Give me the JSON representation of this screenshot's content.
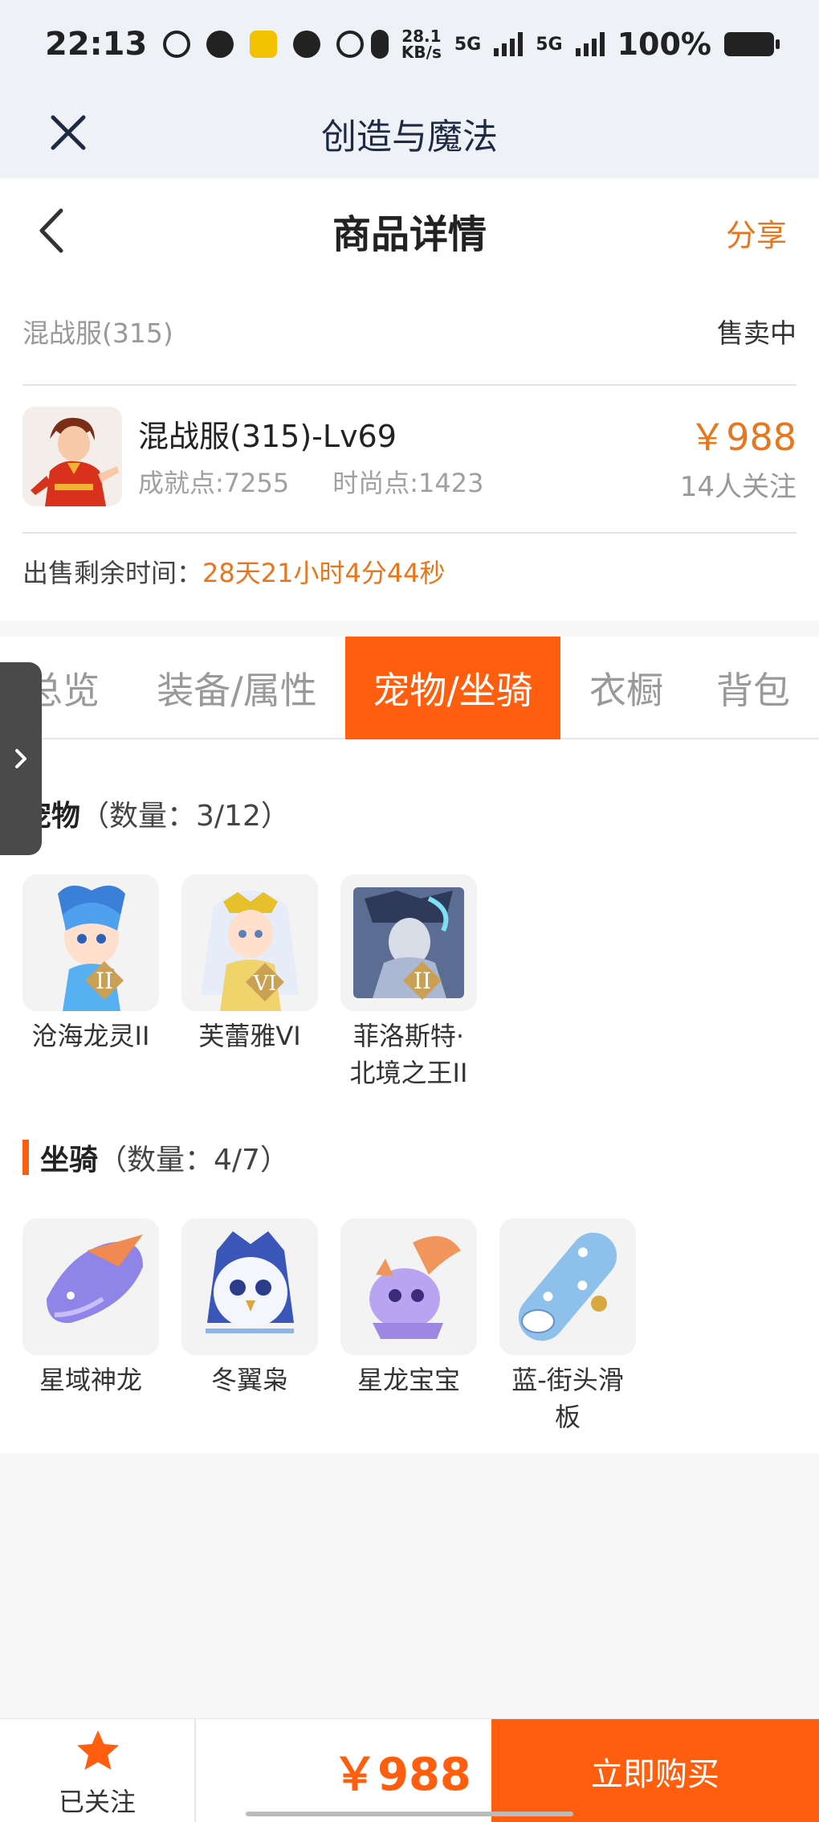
{
  "status_bar": {
    "time": "22:13",
    "net_speed_value": "28.1",
    "net_speed_unit": "KB/s",
    "sim1": "5G",
    "sim2": "5G",
    "battery": "100%"
  },
  "app_header": {
    "title": "创造与魔法"
  },
  "nav": {
    "title": "商品详情",
    "share_label": "分享"
  },
  "listing": {
    "server": "混战服(315)",
    "status": "售卖中",
    "character_name": "混战服(315)-Lv69",
    "achievement": "成就点:7255",
    "fashion": "时尚点:1423",
    "price": "￥988",
    "followers": "14人关注",
    "time_left_label": "出售剩余时间：",
    "time_left_value": "28天21小时4分44秒"
  },
  "tabs": [
    {
      "label": "总览"
    },
    {
      "label": "装备/属性"
    },
    {
      "label": "宠物/坐骑",
      "active": true
    },
    {
      "label": "衣橱"
    },
    {
      "label": "背包"
    }
  ],
  "pets": {
    "title": "宠物",
    "count": "（数量：3/12）",
    "items": [
      {
        "name": "沧海龙灵II"
      },
      {
        "name": "芙蕾雅VI"
      },
      {
        "name": "菲洛斯特·北境之王II"
      }
    ]
  },
  "mounts": {
    "title": "坐骑",
    "count": "（数量：4/7）",
    "items": [
      {
        "name": "星域神龙"
      },
      {
        "name": "冬翼枭"
      },
      {
        "name": "星龙宝宝"
      },
      {
        "name": "蓝-街头滑板"
      }
    ]
  },
  "bottom_bar": {
    "follow_label": "已关注",
    "price": "￥988",
    "buy_label": "立即购买"
  },
  "colors": {
    "accent": "#ff5e0e",
    "price": "#e8761c"
  },
  "icons": [
    "close-icon",
    "back-arrow-icon",
    "star-icon",
    "chevron-right-icon"
  ]
}
